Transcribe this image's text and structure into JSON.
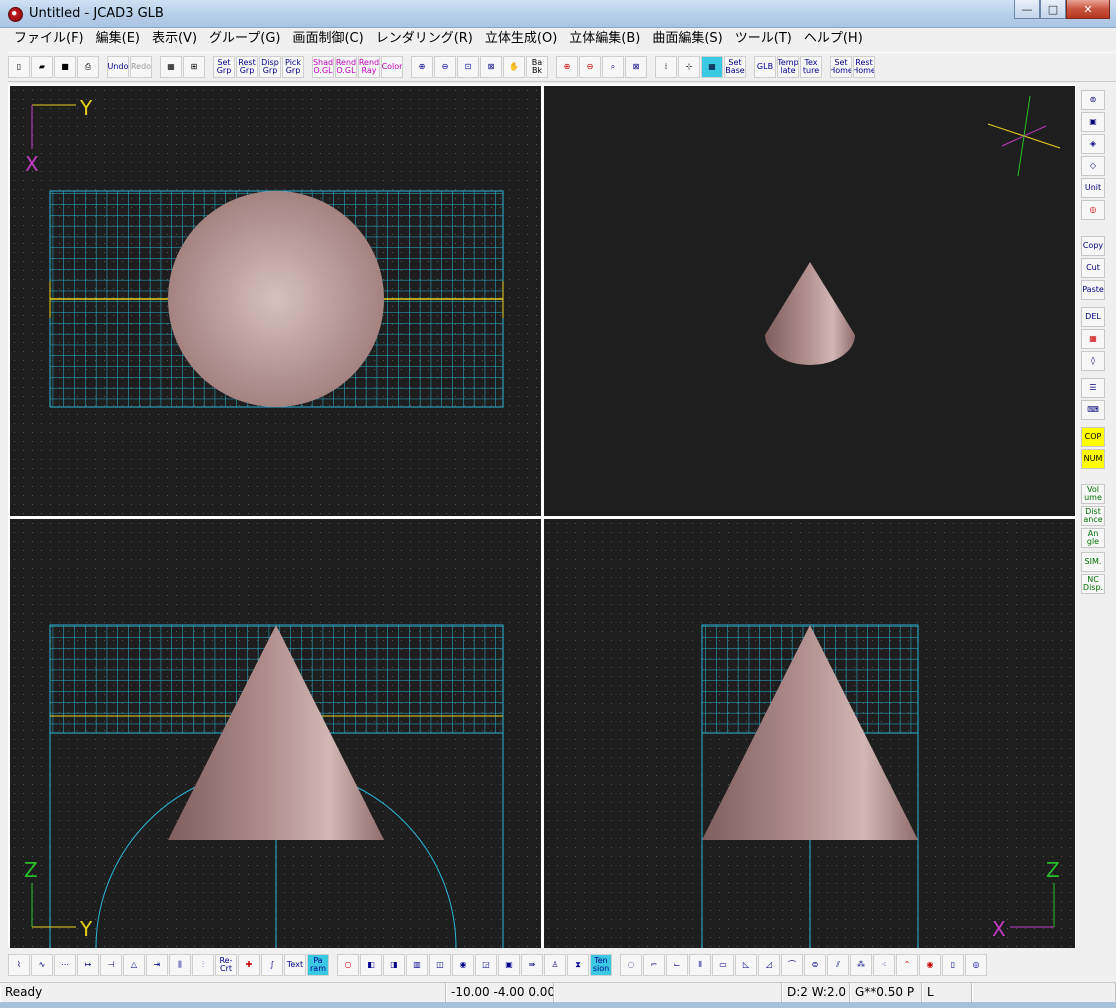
{
  "window": {
    "title": "Untitled - JCAD3 GLB",
    "minimize": "—",
    "maximize": "□",
    "close": "✕"
  },
  "menu": [
    "ファイル(F)",
    "編集(E)",
    "表示(V)",
    "グループ(G)",
    "画面制御(C)",
    "レンダリング(R)",
    "立体生成(O)",
    "立体編集(B)",
    "曲面編集(S)",
    "ツール(T)",
    "ヘルプ(H)"
  ],
  "toolbar": {
    "undo": "Undo",
    "redo": "Redo",
    "set_grp": "Set Grp",
    "rest_grp": "Rest Grp",
    "disp_grp": "Disp Grp",
    "pick_grp": "Pick Grp",
    "shad_ogl": "Shad O.GL",
    "rend_ogl": "Rend O.GL",
    "rend_ray": "Rend Ray",
    "color": "Color",
    "ba_bk": "Ba Bk",
    "set_base": "Set Base",
    "glb": "GLB",
    "template": "Temp late",
    "texture": "Tex ture",
    "set_home": "Set Home",
    "rest_home": "Rest Home"
  },
  "rightbar": {
    "unit": "Unit",
    "copy": "Copy",
    "cut": "Cut",
    "paste": "Paste",
    "del": "DEL",
    "cop": "COP",
    "num": "NUM",
    "volume": "Vol ume",
    "distance": "Dist ance",
    "angle": "An gle",
    "sim": "SIM.",
    "nc_disp": "NC Disp."
  },
  "bottombar": {
    "text": "Text",
    "param": "Pa ram",
    "re_crt": "Re- Crt",
    "tension": "Ten sion"
  },
  "viewports": {
    "top": {
      "axis_h": "Y",
      "axis_v": "X"
    },
    "front": {
      "axis_h": "Y",
      "axis_v": "Z"
    },
    "side": {
      "axis_h": "X",
      "axis_v": "Z"
    }
  },
  "status": {
    "ready": "Ready",
    "coords": "-10.00 -4.00 0.00",
    "d": "D:2 W:2.0",
    "g": "G**0.50 P",
    "l": "L"
  },
  "colors": {
    "viewport_bg": "#1e1e1e",
    "grid": "#2bb7d6",
    "guide": "#e8d21c",
    "cone": "#b89796",
    "axis_y": "#e8d21c",
    "axis_x": "#c23cc3",
    "axis_z": "#28c028"
  }
}
